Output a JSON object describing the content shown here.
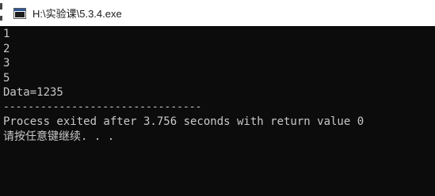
{
  "window": {
    "title": "H:\\实验课\\5.3.4.exe",
    "icon": "console-app-icon"
  },
  "console": {
    "lines": [
      "1",
      "2",
      "3",
      "5",
      "Data=1235",
      "--------------------------------",
      "Process exited after 3.756 seconds with return value 0",
      "请按任意键继续. . ."
    ]
  },
  "colors": {
    "console_bg": "#0c0c0c",
    "console_fg": "#c8c8c8",
    "titlebar_bg": "#ffffff"
  }
}
